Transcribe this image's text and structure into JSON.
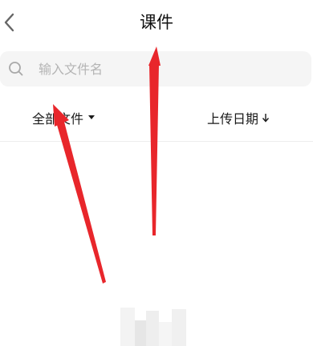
{
  "header": {
    "title": "课件",
    "back_icon": "chevron-left-icon"
  },
  "search": {
    "placeholder": "输入文件名",
    "value": "",
    "icon": "search-icon"
  },
  "filters": {
    "file_type_label": "全部文件",
    "file_type_icon": "caret-down-icon",
    "sort_label": "上传日期",
    "sort_icon": "arrow-down-icon"
  },
  "annotations": {
    "arrow_color": "#e8262b"
  },
  "colors": {
    "search_background": "#f5f5f5",
    "placeholder": "#b4b4b4",
    "text": "#1a1a1a"
  }
}
